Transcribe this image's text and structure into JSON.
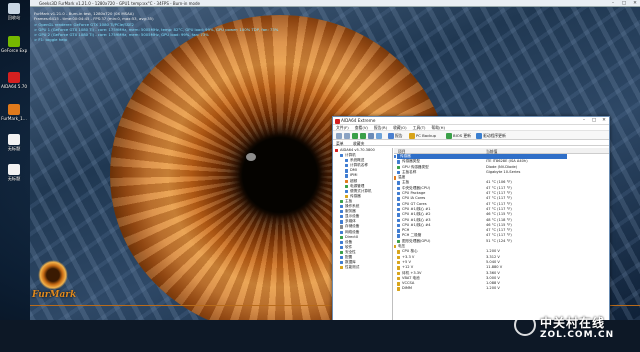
{
  "desktop": {
    "icons": [
      {
        "label": "回收站",
        "color": "#c9d6e3"
      },
      {
        "label": "GeForce Experience",
        "color": "#76b900"
      },
      {
        "label": "AIDA64 5.70",
        "color": "#d42020"
      },
      {
        "label": "FurMark_1...",
        "color": "#e07a1c"
      },
      {
        "label": "无标题",
        "color": "#f2f2f2"
      },
      {
        "label": "无标题",
        "color": "#f2f2f2"
      }
    ]
  },
  "furmark": {
    "title": "Geeks3D FurMark v1.21.0 - 1280x720 - GPU1 temp:xx°C - 34FPS - Burn-in mode",
    "osd": [
      {
        "text": "FurMark v1.21.0 - Burn-in test, 1280x720 (0X MSAA)",
        "color": "white"
      },
      {
        "text": "Frames:6415 - time:00:04:45 - FPS:37 (min:0, max:53, avg:35)",
        "color": "white"
      },
      {
        "text": "> OpenGL renderer: GeForce GTX 1080 Ti/PCIe/SSE2",
        "color": "cyan"
      },
      {
        "text": "> GPU 1 (GeForce GTX 1080 Ti) - core: 1759MHz, mem: 5005MHz, temp: 82°C, GPU load: 99%, GPU power: 100% TDP, fan: 73%",
        "color": "cyan"
      },
      {
        "text": "> GPU 2 (GeForce GTX 1080 Ti) - core: 1759MHz, mem: 5005MHz, GPU load: 99%, fan: 73%",
        "color": "cyan"
      },
      {
        "text": "> F1: toggle help",
        "color": "cyan"
      }
    ],
    "logo_text": "FurMark"
  },
  "aida": {
    "title": "AIDA64 Extreme",
    "menu": [
      "文件(F)",
      "查看(V)",
      "报告(R)",
      "收藏(O)",
      "工具(T)",
      "帮助(H)"
    ],
    "toolbar": [
      {
        "label": "报告",
        "color": "#4a7fd0"
      },
      {
        "label": "PC Backup",
        "color": "#d8a41a"
      },
      {
        "label": "BIOS 更新",
        "color": "#3aa048"
      },
      {
        "label": "驱动程序更新",
        "color": "#3a7fd0"
      }
    ],
    "tabs": [
      "菜单",
      "收藏夹"
    ],
    "columns": [
      "项目",
      "当前值"
    ],
    "tree": [
      {
        "label": "AIDA64 v5.70.3800",
        "indent": 0,
        "color": "#d42020"
      },
      {
        "label": "计算机",
        "indent": 1,
        "color": "#3f7cd1"
      },
      {
        "label": "系统概述",
        "indent": 2,
        "color": "#3f7cd1"
      },
      {
        "label": "计算机名称",
        "indent": 2,
        "color": "#3f7cd1"
      },
      {
        "label": "DMI",
        "indent": 2,
        "color": "#3f7cd1"
      },
      {
        "label": "IPMI",
        "indent": 2,
        "color": "#3f7cd1"
      },
      {
        "label": "超频",
        "indent": 2,
        "color": "#e07a1c"
      },
      {
        "label": "电源管理",
        "indent": 2,
        "color": "#3aa048"
      },
      {
        "label": "便携式计算机",
        "indent": 2,
        "color": "#3f7cd1"
      },
      {
        "label": "传感器",
        "indent": 2,
        "color": "#d8a41a"
      },
      {
        "label": "主板",
        "indent": 1,
        "color": "#3aa048"
      },
      {
        "label": "操作系统",
        "indent": 1,
        "color": "#3f7cd1"
      },
      {
        "label": "服务器",
        "indent": 1,
        "color": "#3f7cd1"
      },
      {
        "label": "显示设备",
        "indent": 1,
        "color": "#3f7cd1"
      },
      {
        "label": "多媒体",
        "indent": 1,
        "color": "#3f7cd1"
      },
      {
        "label": "存储设备",
        "indent": 1,
        "color": "#8a8a8a"
      },
      {
        "label": "网络设备",
        "indent": 1,
        "color": "#3f7cd1"
      },
      {
        "label": "DirectX",
        "indent": 1,
        "color": "#3aa048"
      },
      {
        "label": "设备",
        "indent": 1,
        "color": "#3f7cd1"
      },
      {
        "label": "软件",
        "indent": 1,
        "color": "#3f7cd1"
      },
      {
        "label": "安全性",
        "indent": 1,
        "color": "#3aa048"
      },
      {
        "label": "配置",
        "indent": 1,
        "color": "#3f7cd1"
      },
      {
        "label": "数据库",
        "indent": 1,
        "color": "#3f7cd1"
      },
      {
        "label": "性能测试",
        "indent": 1,
        "color": "#d8a41a"
      }
    ],
    "list": [
      {
        "field": "传感器",
        "value": "",
        "section": true,
        "selected": true,
        "color": "#3f7cd1"
      },
      {
        "field": "传感器类型",
        "value": "ITE IT8628E (ISA A40h)",
        "color": "#3f7cd1"
      },
      {
        "field": "GPU 传感器类型",
        "value": "Diode (NV-Diode)",
        "color": "#3aa048"
      },
      {
        "field": "主板名称",
        "value": "Gigabyte 10-Series",
        "color": "#3f7cd1"
      },
      {
        "field": "温度",
        "value": "",
        "section": true,
        "color": "#e07a1c"
      },
      {
        "field": "主板",
        "value": "41 °C (106 °F)",
        "color": "#3f7cd1"
      },
      {
        "field": "中央处理器(CPU)",
        "value": "47 °C (117 °F)",
        "color": "#3f7cd1"
      },
      {
        "field": "CPU Package",
        "value": "47 °C (117 °F)",
        "color": "#3f7cd1"
      },
      {
        "field": "CPU IA Cores",
        "value": "47 °C (117 °F)",
        "color": "#3f7cd1"
      },
      {
        "field": "CPU GT Cores",
        "value": "47 °C (117 °F)",
        "color": "#3f7cd1"
      },
      {
        "field": "CPU #1/核心 #1",
        "value": "47 °C (117 °F)",
        "color": "#3f7cd1"
      },
      {
        "field": "CPU #1/核心 #2",
        "value": "46 °C (115 °F)",
        "color": "#3f7cd1"
      },
      {
        "field": "CPU #1/核心 #3",
        "value": "48 °C (118 °F)",
        "color": "#3f7cd1"
      },
      {
        "field": "CPU #1/核心 #4",
        "value": "46 °C (115 °F)",
        "color": "#3f7cd1"
      },
      {
        "field": "PCH",
        "value": "47 °C (117 °F)",
        "color": "#3f7cd1"
      },
      {
        "field": "PCH 二极管",
        "value": "47 °C (117 °F)",
        "color": "#3f7cd1"
      },
      {
        "field": "图形处理器(GPU)",
        "value": "51 °C (124 °F)",
        "color": "#3aa048"
      },
      {
        "field": "电压",
        "value": "",
        "section": true,
        "color": "#d8a41a"
      },
      {
        "field": "CPU 核心",
        "value": "1.200 V",
        "color": "#d8a41a"
      },
      {
        "field": "+3.3 V",
        "value": "3.312 V",
        "color": "#d8a41a"
      },
      {
        "field": "+5 V",
        "value": "5.040 V",
        "color": "#d8a41a"
      },
      {
        "field": "+12 V",
        "value": "11.880 V",
        "color": "#d8a41a"
      },
      {
        "field": "待机 +3.3V",
        "value": "3.360 V",
        "color": "#d8a41a"
      },
      {
        "field": "VBAT 电池",
        "value": "3.000 V",
        "color": "#d8a41a"
      },
      {
        "field": "VCCSA",
        "value": "1.088 V",
        "color": "#d8a41a"
      },
      {
        "field": "DIMM",
        "value": "1.200 V",
        "color": "#d8a41a"
      }
    ]
  },
  "watermark": {
    "cn": "中关村在线",
    "url": "ZOL.COM.CN"
  }
}
